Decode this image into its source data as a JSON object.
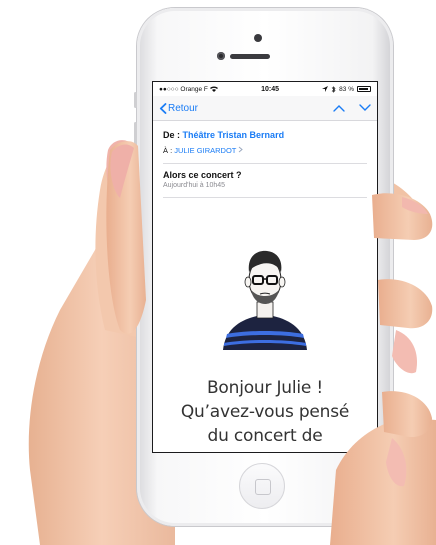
{
  "status": {
    "carrier": "●●○○○ Orange F",
    "time": "10:45",
    "battery": "83 %"
  },
  "nav": {
    "back_label": "Retour"
  },
  "mail": {
    "from_prefix": "De :",
    "from_name": "Théâtre Tristan Bernard",
    "to_prefix": "À :",
    "to_name": "JULIE GIRARDOT",
    "subject": "Alors ce concert ?",
    "date": "Aujourd'hui à 10h45"
  },
  "body": {
    "line1": "Bonjour Julie !",
    "line2": "Qu’avez-vous pensé",
    "line3": "du concert de"
  },
  "colors": {
    "accent": "#1a7cf5",
    "skin": "#f4c9ae",
    "nail": "#f0b9b0"
  },
  "icons": [
    "wifi-icon",
    "location-icon",
    "bluetooth-icon",
    "battery-icon",
    "chevron-left-icon",
    "chevron-up-icon",
    "chevron-down-icon",
    "chevron-right-icon"
  ]
}
